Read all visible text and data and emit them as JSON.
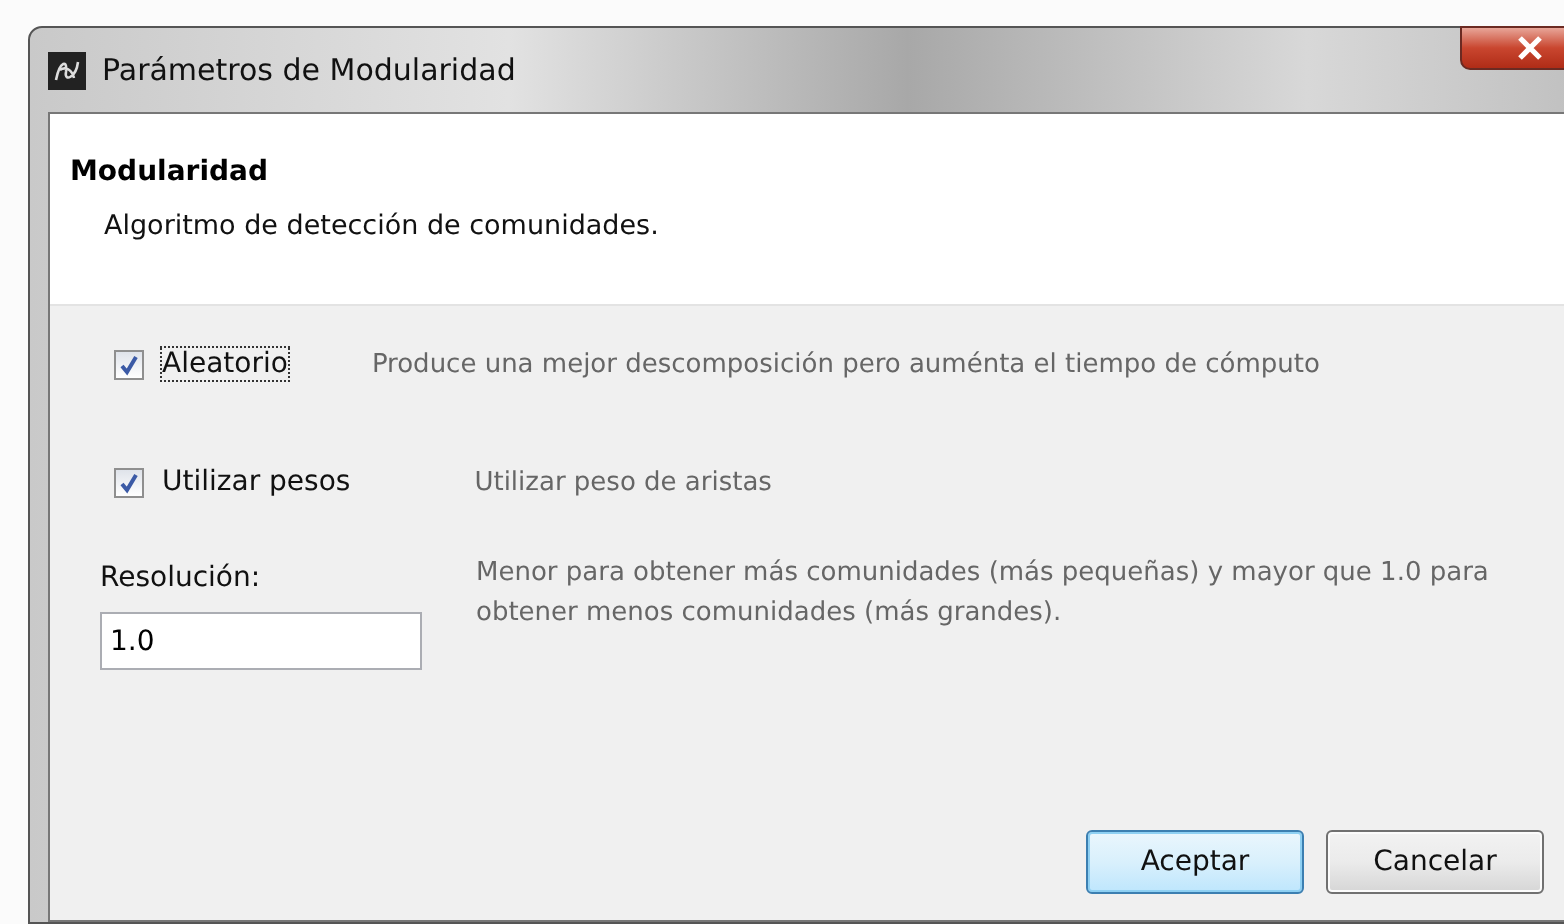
{
  "window": {
    "title": "Parámetros de Modularidad"
  },
  "header": {
    "title": "Modularidad",
    "description": "Algoritmo de detección de comunidades."
  },
  "options": [
    {
      "label": "Aleatorio",
      "checked": true,
      "focused": true,
      "description": "Produce una mejor descomposición pero auménta el tiempo de cómputo"
    },
    {
      "label": "Utilizar pesos",
      "checked": true,
      "focused": false,
      "description": "Utilizar peso de aristas"
    }
  ],
  "resolution": {
    "label": "Resolución:",
    "value": "1.0",
    "description": "Menor para obtener más comunidades (más pequeñas) y mayor que 1.0 para obtener menos comunidades (más grandes)."
  },
  "buttons": [
    {
      "label": "Aceptar",
      "default": true
    },
    {
      "label": "Cancelar",
      "default": false
    }
  ]
}
